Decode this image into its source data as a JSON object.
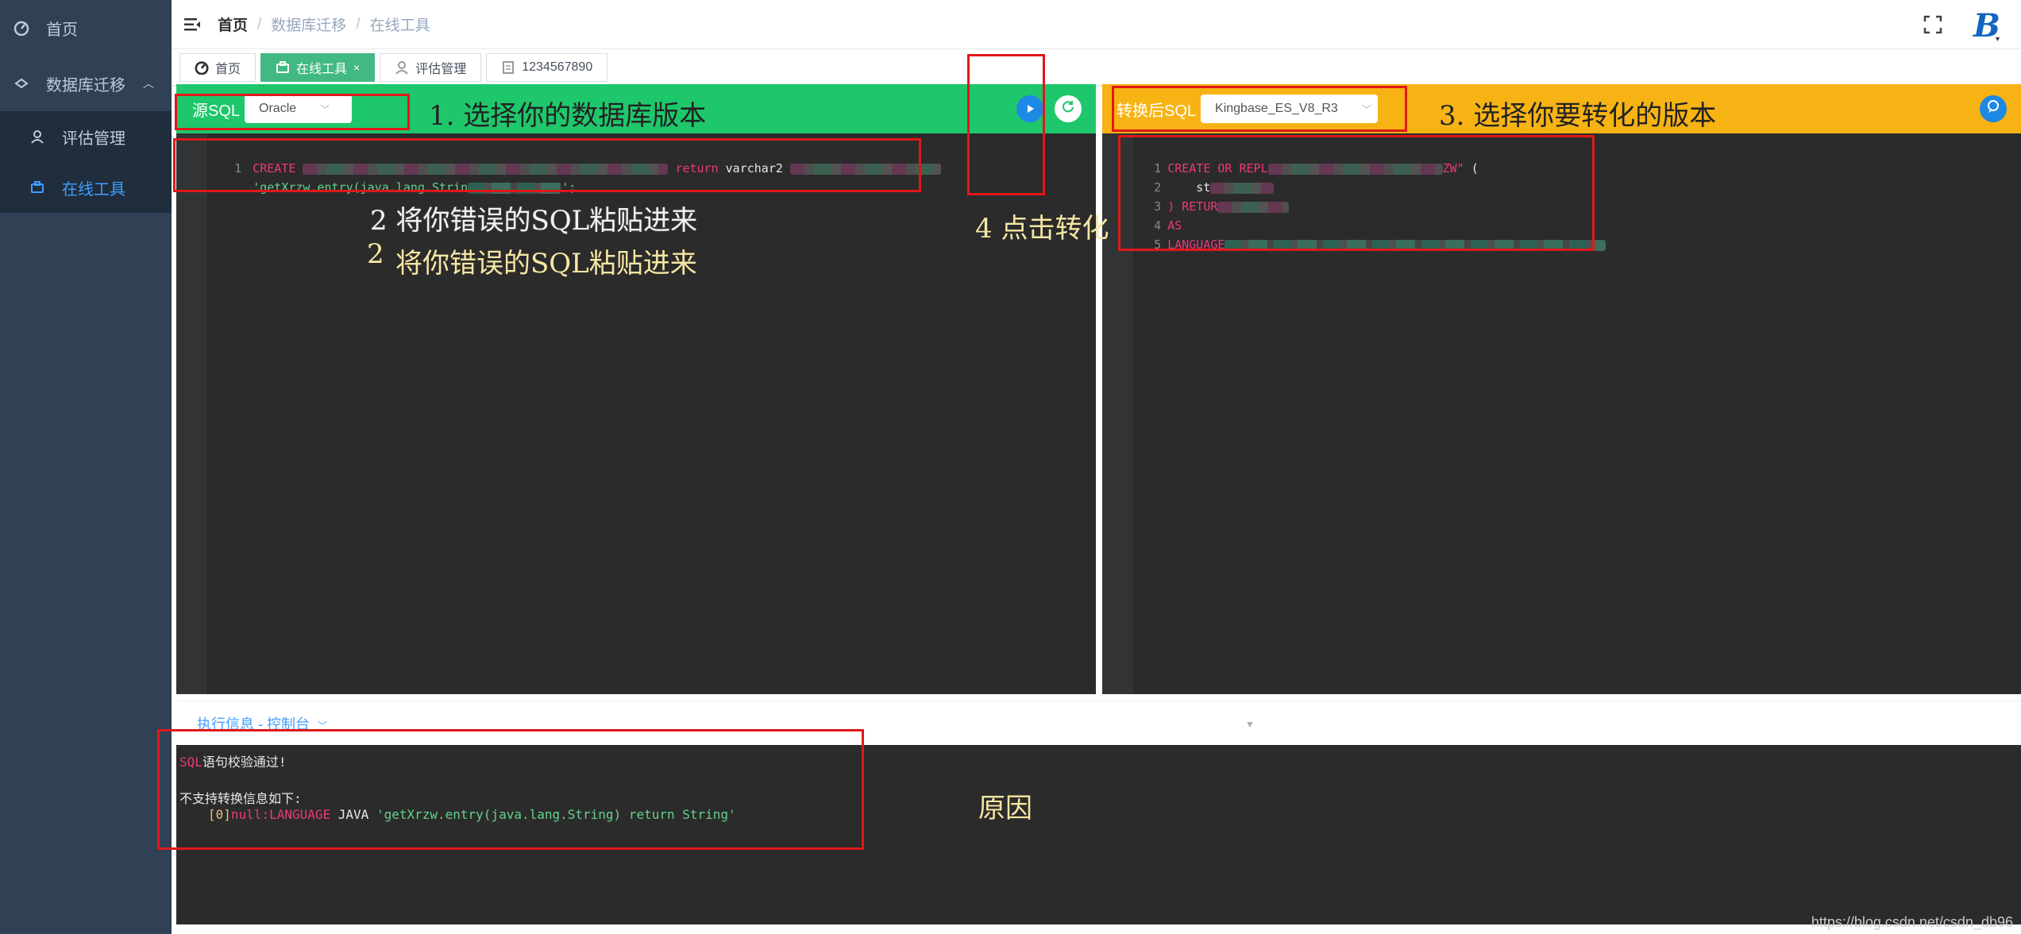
{
  "sidebar": {
    "items": [
      {
        "label": "首页",
        "icon": "dashboard-icon"
      },
      {
        "label": "数据库迁移",
        "icon": "migrate-icon",
        "expanded": true
      },
      {
        "label": "评估管理",
        "icon": "user-check-icon"
      },
      {
        "label": "在线工具",
        "icon": "toolbox-icon",
        "active": true
      }
    ]
  },
  "header": {
    "breadcrumb": [
      "首页",
      "数据库迁移",
      "在线工具"
    ]
  },
  "tabs": [
    {
      "label": "首页",
      "icon": "dashboard-icon"
    },
    {
      "label": "在线工具",
      "icon": "toolbox-icon",
      "active": true,
      "close": "×"
    },
    {
      "label": "评估管理",
      "icon": "user-icon"
    },
    {
      "label": "1234567890",
      "icon": "doc-icon"
    }
  ],
  "left_panel": {
    "label": "源SQL",
    "select_value": "Oracle",
    "code": {
      "line1_num": "1",
      "line1_kw": "CREATE",
      "line1_return": "return",
      "line1_type": "varchar2",
      "line2_str": "'getXrzw.entry(java.lang.Strin",
      "line2_end": "';"
    }
  },
  "right_panel": {
    "label": "转换后SQL",
    "select_value": "Kingbase_ES_V8_R3",
    "code": {
      "l1_num": "1",
      "l1_a": "CREATE OR REPL",
      "l1_b": "ZW\"",
      "l1_c": " (",
      "l2_num": "2",
      "l2_a": "    st",
      "l3_num": "3",
      "l3_a": ") RETUR",
      "l4_num": "4",
      "l4_a": "AS",
      "l5_num": "5",
      "l5_a": "LANGUAGE"
    }
  },
  "console": {
    "title": "执行信息 - 控制台",
    "line1_prefix": "SQL",
    "line1_rest": "语句校验通过!",
    "line2": "不支持转换信息如下:",
    "line3_idx": "[0]",
    "line3_null": "null",
    "line3_lang": ":LANGUAGE",
    "line3_java": " JAVA ",
    "line3_str": "'getXrzw.entry(java.lang.String) return String'"
  },
  "annotations": {
    "step1": "1. 选择你的数据库版本",
    "step2a": "2 将你错误的SQL粘贴进来",
    "step2b_num": "2",
    "step2b": "将你错误的SQL粘贴进来",
    "step3": "3. 选择你要转化的版本",
    "step4": "4 点击转化",
    "reason": "原因"
  },
  "watermark": "https://blog.csdn.net/csdn_db96",
  "colors": {
    "sidebar_bg": "#304156",
    "source_header": "#1ec76b",
    "target_header": "#f7b314",
    "active_tab": "#42b983",
    "editor_bg": "#2b2b2b",
    "annotation_red": "#e01818"
  }
}
